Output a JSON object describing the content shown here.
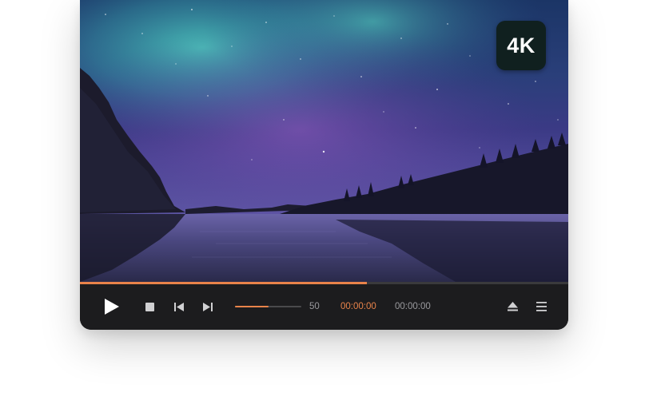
{
  "badge": {
    "label": "4K"
  },
  "playback": {
    "progress_fraction": 0.588
  },
  "volume": {
    "value": "50",
    "fraction": 0.5
  },
  "time": {
    "current": "00:00:00",
    "total": "00:00:00"
  },
  "colors": {
    "accent": "#e8834a",
    "controls_bg": "#1c1c1e",
    "badge_bg": "#10201f",
    "icon": "#ffffff",
    "secondary_text": "#9a9a9e"
  },
  "icons": {
    "play": "play-icon",
    "stop": "stop-icon",
    "previous": "skip-previous-icon",
    "next": "skip-next-icon",
    "eject": "eject-icon",
    "menu": "menu-icon"
  }
}
